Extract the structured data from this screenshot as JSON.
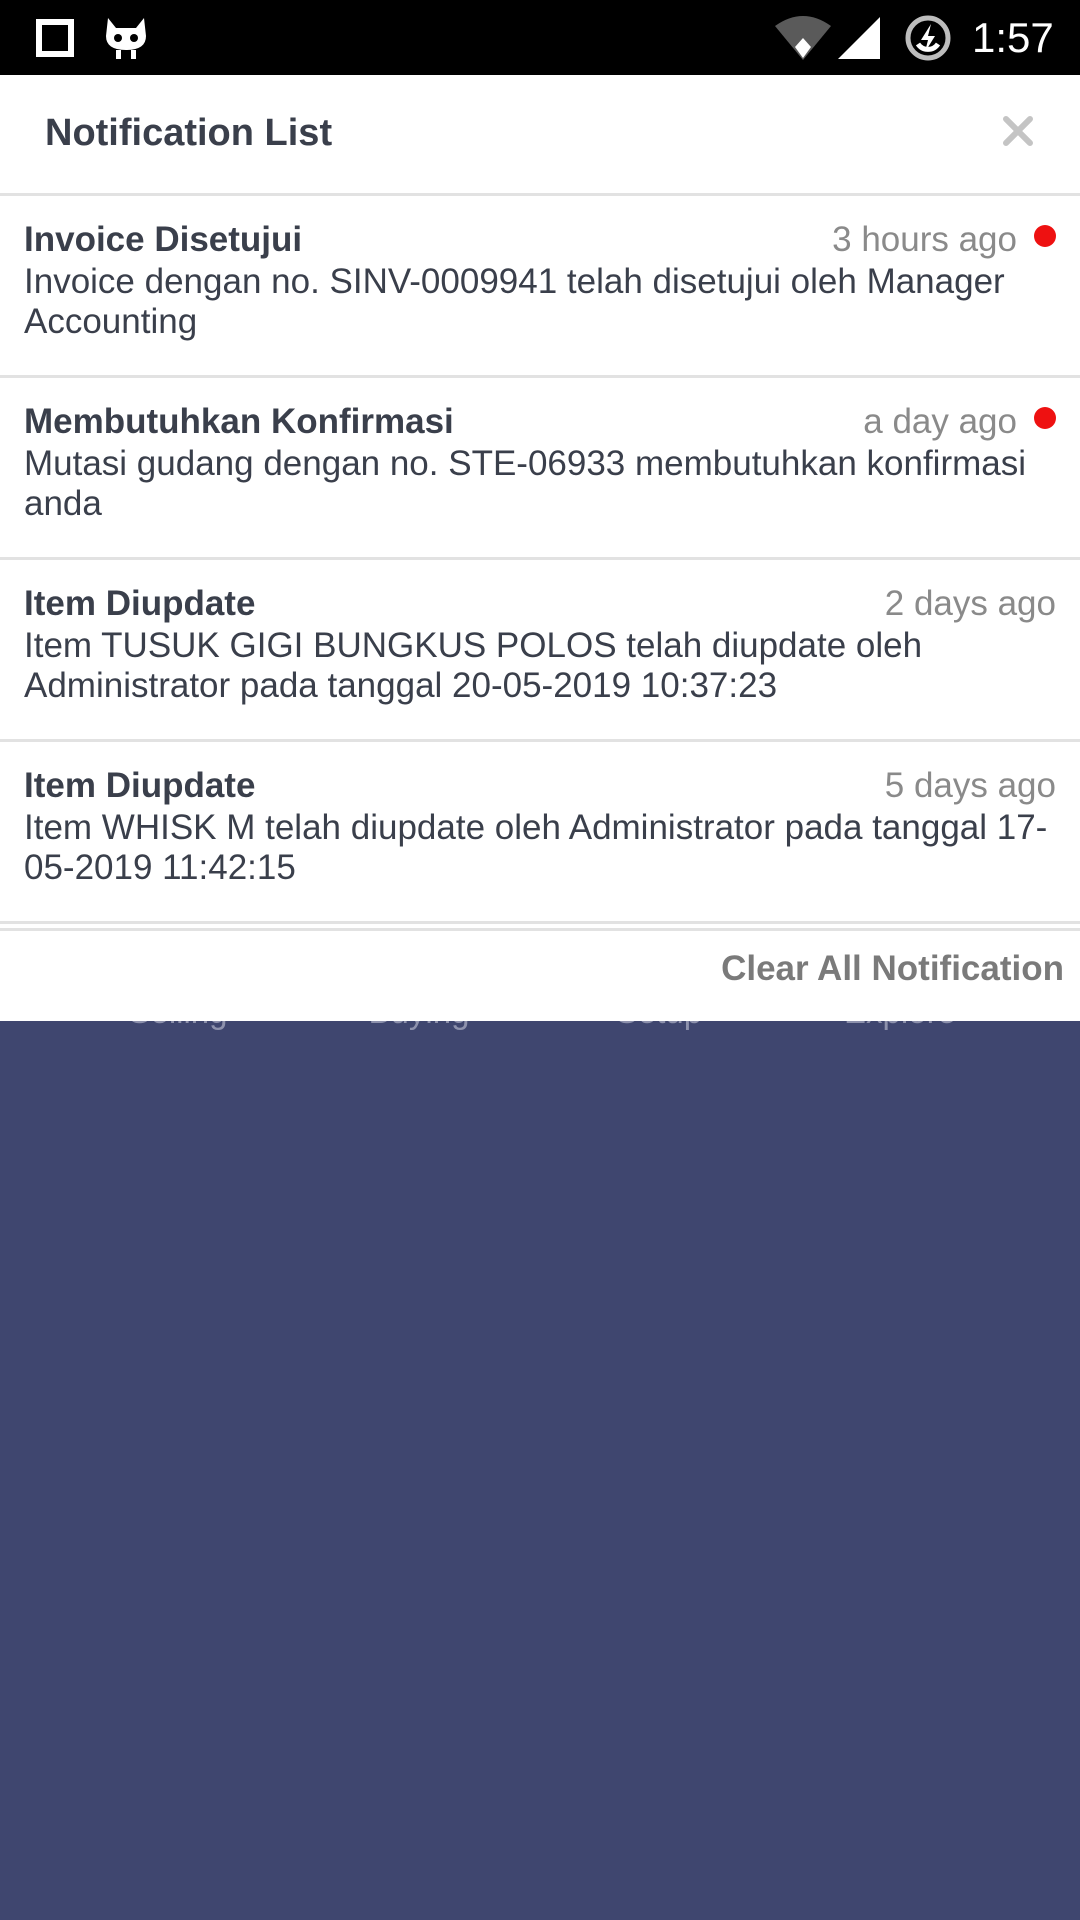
{
  "status_bar": {
    "time": "1:57",
    "icons": [
      "square-notification-icon",
      "cyanogen-mascot-icon",
      "wifi-icon",
      "cell-signal-icon",
      "battery-charging-icon"
    ]
  },
  "background_nav": {
    "labels": [
      "Selling",
      "Buying",
      "Setup",
      "Explore"
    ],
    "color": "#3f466f"
  },
  "panel": {
    "title": "Notification List",
    "close_icon": "close-icon",
    "clear_all_label": "Clear All Notification",
    "notifications": [
      {
        "title": "Invoice Disetujui",
        "time": "3 hours ago",
        "unread": true,
        "body": "Invoice dengan no. SINV-0009941 telah disetujui oleh Manager Accounting"
      },
      {
        "title": "Membutuhkan Konfirmasi",
        "time": "a day ago",
        "unread": true,
        "body": "Mutasi gudang dengan no. STE-06933 membutuhkan konfirmasi anda"
      },
      {
        "title": "Item Diupdate",
        "time": "2 days ago",
        "unread": false,
        "body": "Item TUSUK GIGI BUNGKUS POLOS telah diupdate oleh Administrator pada tanggal 20-05-2019 10:37:23"
      },
      {
        "title": "Item Diupdate",
        "time": "5 days ago",
        "unread": false,
        "body": "Item WHISK M telah diupdate oleh Administrator pada tanggal 17-05-2019 11:42:15"
      }
    ]
  },
  "colors": {
    "unread_dot": "#ee1111",
    "title_text": "#3a3f4b",
    "muted_text": "#8a8a8a",
    "backdrop": "#3f466f"
  }
}
